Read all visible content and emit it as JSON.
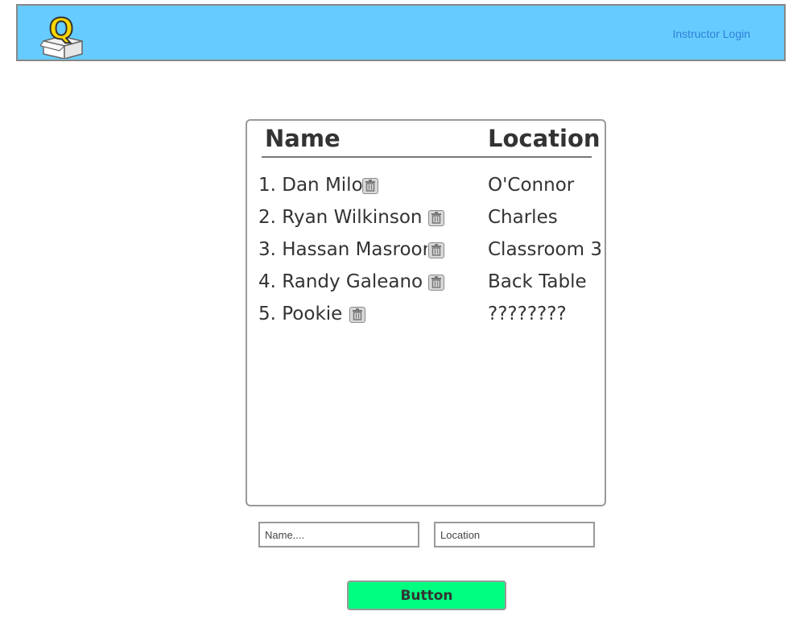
{
  "header": {
    "login_link": "Instructor Login",
    "logo_letter": "Q"
  },
  "queue": {
    "name_header": "Name",
    "location_header": "Location",
    "entries": [
      {
        "name": "1. Dan Milo",
        "location": "O'Connor"
      },
      {
        "name": "2. Ryan Wilkinson",
        "location": "Charles"
      },
      {
        "name": "3. Hassan Masroor",
        "location": "Classroom 3"
      },
      {
        "name": "4. Randy Galeano",
        "location": "Back Table"
      },
      {
        "name": "5. Pookie",
        "location": "????????"
      }
    ],
    "delete_icon": "trash-icon"
  },
  "form": {
    "name_placeholder": "Name....",
    "location_placeholder": "Location",
    "button_label": "Button"
  },
  "colors": {
    "header_bg": "#66ccff",
    "button_bg": "#00ff80",
    "link": "#2f7fd8"
  }
}
